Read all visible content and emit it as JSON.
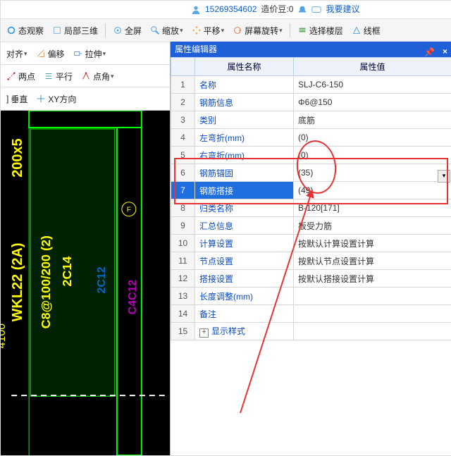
{
  "info": {
    "user": "15269354602",
    "beans_label": "造价豆:0",
    "suggest": "我要建议"
  },
  "toolbar1": {
    "view": "态观察",
    "local3d": "局部三维",
    "full": "全屏",
    "zoom": "缩放",
    "pan": "平移",
    "rot": "屏幕旋转",
    "floor": "选择楼层",
    "wire": "线框"
  },
  "toolbar2": {
    "align": "对齐",
    "offset": "偏移",
    "stretch": "拉伸"
  },
  "toolbar3": {
    "two": "两点",
    "parallel": "平行",
    "corner": "点角"
  },
  "toolbar4": {
    "vert": "垂直",
    "xy": "XY方向"
  },
  "panel": {
    "title": "属性编辑器",
    "col_name": "属性名称",
    "col_val": "属性值",
    "rows": [
      {
        "i": "1",
        "n": "名称",
        "v": "SLJ-C6-150"
      },
      {
        "i": "2",
        "n": "钢筋信息",
        "v": "Φ6@150"
      },
      {
        "i": "3",
        "n": "类别",
        "v": "底筋"
      },
      {
        "i": "4",
        "n": "左弯折(mm)",
        "v": "(0)"
      },
      {
        "i": "5",
        "n": "右弯折(mm)",
        "v": "(0)"
      },
      {
        "i": "6",
        "n": "钢筋锚固",
        "v": "(35)"
      },
      {
        "i": "7",
        "n": "钢筋搭接",
        "v": "(49)"
      },
      {
        "i": "8",
        "n": "归类名称",
        "v": "B-120[171]"
      },
      {
        "i": "9",
        "n": "汇总信息",
        "v": "板受力筋"
      },
      {
        "i": "10",
        "n": "计算设置",
        "v": "按默认计算设置计算"
      },
      {
        "i": "11",
        "n": "节点设置",
        "v": "按默认节点设置计算"
      },
      {
        "i": "12",
        "n": "搭接设置",
        "v": "按默认搭接设置计算"
      },
      {
        "i": "13",
        "n": "长度调整(mm)",
        "v": ""
      },
      {
        "i": "14",
        "n": "备注",
        "v": ""
      },
      {
        "i": "15",
        "n": "显示样式",
        "v": "",
        "plus": true,
        "gray": true
      }
    ]
  },
  "cad": {
    "beam": "WKL22 (2A)",
    "dim1": "200x5",
    "dim2": "C8@100/200 (2)",
    "dim3": "2C14",
    "dim4": "2C12",
    "len": "4100"
  }
}
